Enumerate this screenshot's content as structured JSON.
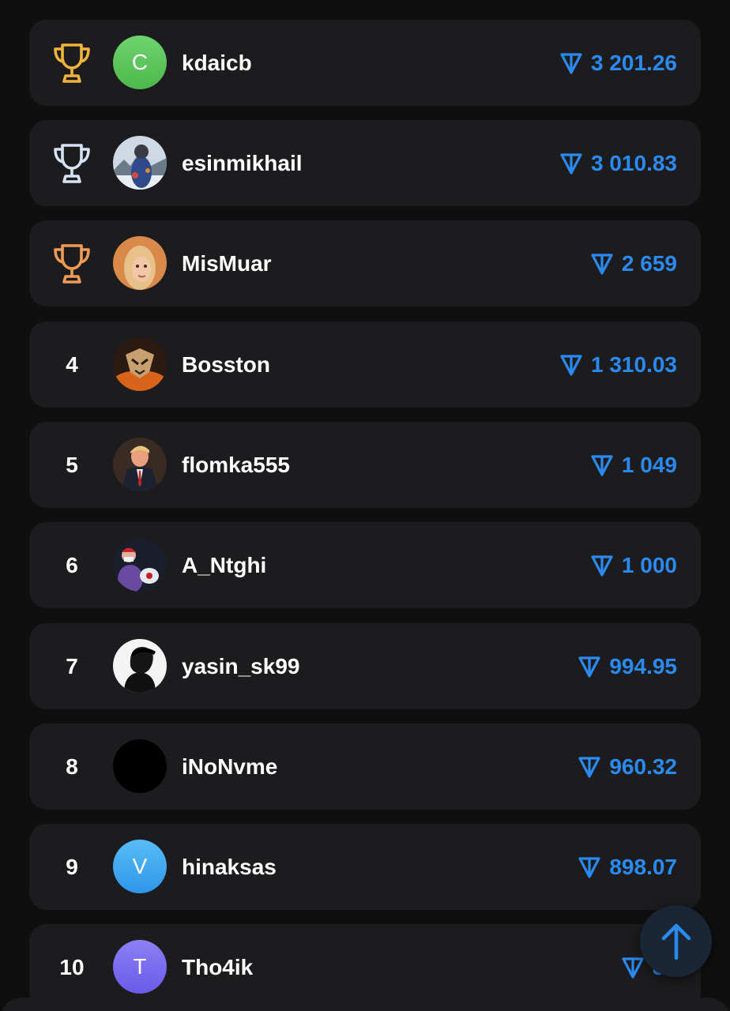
{
  "colors": {
    "background": "#0f0f10",
    "card": "#1c1c1e",
    "accent": "#2a8af0",
    "gold": "#f0b43c",
    "silver": "#d5e3f5",
    "bronze": "#f09a55"
  },
  "leaderboard": {
    "currency_icon": "ton-icon",
    "entries": [
      {
        "rank": "1",
        "trophy": "gold-trophy-icon",
        "avatar_letter": "C",
        "avatar_type": "letter",
        "avatar_color": "#5cc95c",
        "name": "kdaicb",
        "amount": "3 201.26"
      },
      {
        "rank": "2",
        "trophy": "silver-trophy-icon",
        "avatar_letter": "",
        "avatar_type": "photo",
        "name": "esinmikhail",
        "amount": "3 010.83"
      },
      {
        "rank": "3",
        "trophy": "bronze-trophy-icon",
        "avatar_letter": "",
        "avatar_type": "photo",
        "name": "MisMuar",
        "amount": "2 659"
      },
      {
        "rank": "4",
        "trophy": "",
        "avatar_letter": "",
        "avatar_type": "photo",
        "name": "Bosston",
        "amount": "1 310.03"
      },
      {
        "rank": "5",
        "trophy": "",
        "avatar_letter": "",
        "avatar_type": "photo",
        "name": "flomka555",
        "amount": "1 049"
      },
      {
        "rank": "6",
        "trophy": "",
        "avatar_letter": "",
        "avatar_type": "photo",
        "name": "A_Ntghi",
        "amount": "1 000"
      },
      {
        "rank": "7",
        "trophy": "",
        "avatar_letter": "",
        "avatar_type": "photo",
        "name": "yasin_sk99",
        "amount": "994.95"
      },
      {
        "rank": "8",
        "trophy": "",
        "avatar_letter": "",
        "avatar_type": "photo",
        "name": "iNoNvme",
        "amount": "960.32"
      },
      {
        "rank": "9",
        "trophy": "",
        "avatar_letter": "V",
        "avatar_type": "letter",
        "avatar_color": "#3aa8f0",
        "name": "hinaksas",
        "amount": "898.07"
      },
      {
        "rank": "10",
        "trophy": "",
        "avatar_letter": "T",
        "avatar_type": "letter",
        "avatar_color": "#7a6cf0",
        "name": "Tho4ik",
        "amount": "88"
      }
    ]
  },
  "scroll_top_button": {
    "icon": "arrow-up-icon"
  }
}
